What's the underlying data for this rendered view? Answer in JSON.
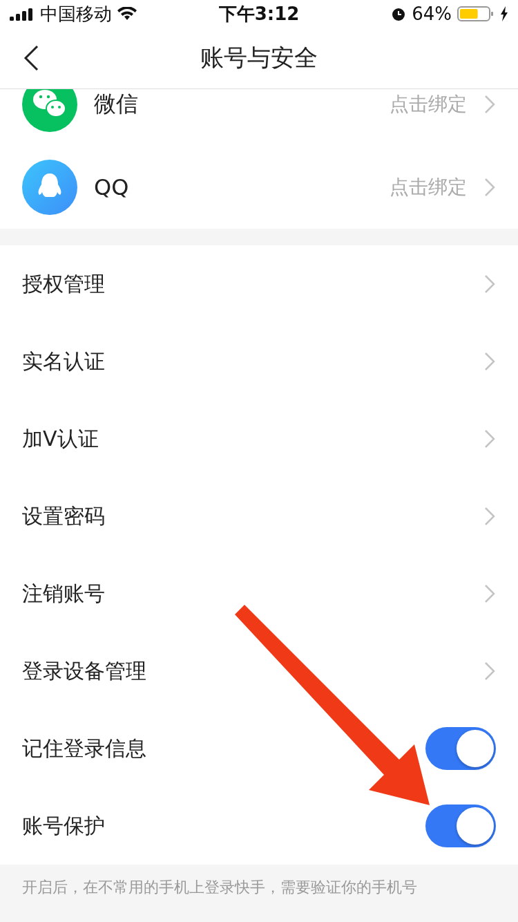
{
  "status_bar": {
    "carrier": "中国移动",
    "time": "下午3:12",
    "battery_percent": "64%",
    "battery": {
      "level": 0.64
    }
  },
  "nav": {
    "title": "账号与安全"
  },
  "accounts": [
    {
      "kind": "wechat",
      "name": "微信",
      "action": "点击绑定"
    },
    {
      "kind": "qq",
      "name": "QQ",
      "action": "点击绑定"
    }
  ],
  "settings": [
    {
      "kind": "link",
      "label": "授权管理"
    },
    {
      "kind": "link",
      "label": "实名认证"
    },
    {
      "kind": "link",
      "label": "加V认证"
    },
    {
      "kind": "link",
      "label": "设置密码"
    },
    {
      "kind": "link",
      "label": "注销账号"
    },
    {
      "kind": "link",
      "label": "登录设备管理"
    },
    {
      "kind": "toggle",
      "label": "记住登录信息",
      "on": true
    },
    {
      "kind": "toggle",
      "label": "账号保护",
      "on": true
    }
  ],
  "footer_note": "开启后，在不常用的手机上登录快手，需要验证你的手机号"
}
